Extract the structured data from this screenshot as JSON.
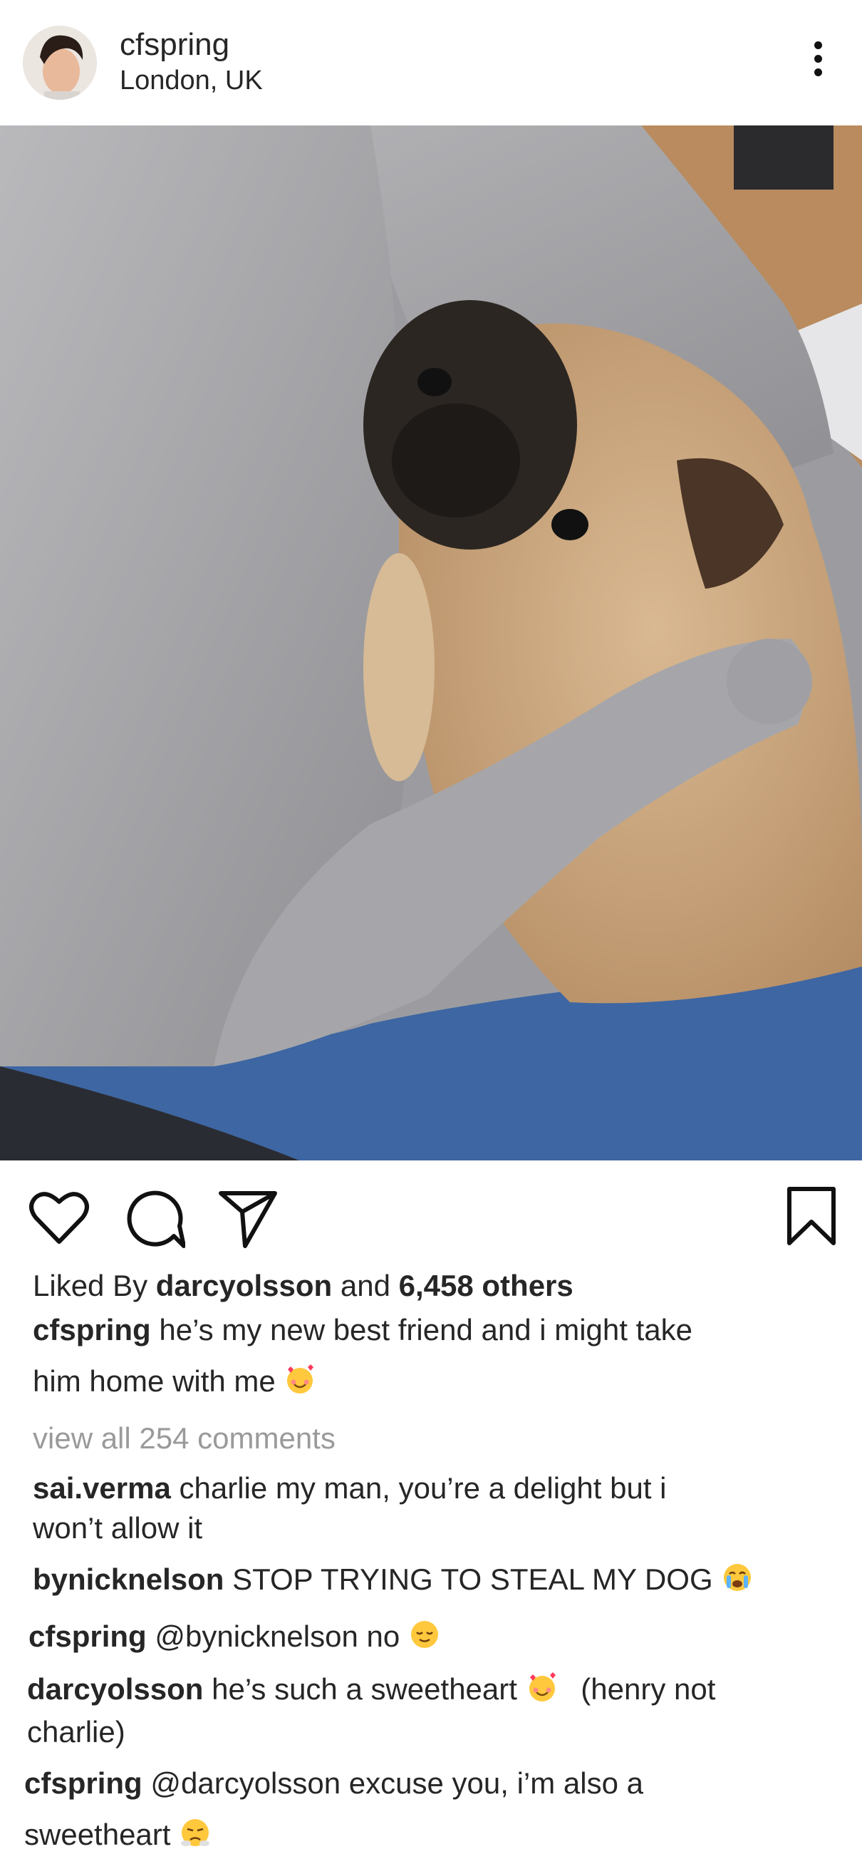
{
  "post": {
    "username": "cfspring",
    "location": "London, UK"
  },
  "likes": {
    "prefix": "Liked By",
    "liker": "darcyolsson",
    "and": "and",
    "others": "6,458 others"
  },
  "caption": {
    "author": "cfspring",
    "line1": "he’s my new best friend and i might take",
    "line2": "him home with me"
  },
  "view_all_comments": "view all 254 comments",
  "comments": [
    {
      "author": "sai.verma",
      "line1": "charlie my man, you’re a delight but i",
      "line2": "won’t allow it"
    },
    {
      "author": "bynicknelson",
      "line1": "STOP TRYING TO STEAL MY DOG"
    },
    {
      "author": "cfspring",
      "line1": "@bynicknelson no"
    },
    {
      "author": "darcyolsson",
      "line1": "he’s such a sweetheart",
      "line1_tail": "(henry not",
      "line2": "charlie)"
    },
    {
      "author": "cfspring",
      "line1": "@darcyolsson excuse you, i’m also a",
      "line2": "sweetheart"
    }
  ],
  "icons": [
    "heart-icon",
    "comment-icon",
    "share-icon",
    "bookmark-icon",
    "more-options-icon"
  ],
  "colors": {
    "text": "#262626",
    "muted": "#9a9a9a",
    "background": "#ffffff"
  }
}
